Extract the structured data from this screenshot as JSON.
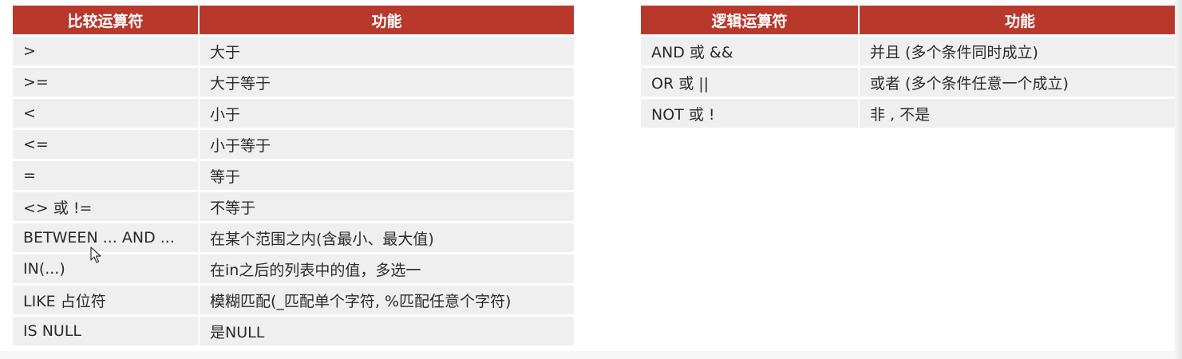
{
  "comparison_table": {
    "headers": [
      "比较运算符",
      "功能"
    ],
    "rows": [
      {
        "operator": ">",
        "function": "大于"
      },
      {
        "operator": ">=",
        "function": "大于等于"
      },
      {
        "operator": "<",
        "function": "小于"
      },
      {
        "operator": "<=",
        "function": "小于等于"
      },
      {
        "operator": "=",
        "function": "等于"
      },
      {
        "operator": "<> 或 !=",
        "function": "不等于"
      },
      {
        "operator": "BETWEEN ... AND ...",
        "function": "在某个范围之内(含最小、最大值)"
      },
      {
        "operator": "IN(...)",
        "function": "在in之后的列表中的值，多选一"
      },
      {
        "operator": "LIKE 占位符",
        "function": "模糊匹配(_匹配单个字符, %匹配任意个字符)"
      },
      {
        "operator": "IS NULL",
        "function": "是NULL"
      }
    ]
  },
  "logical_table": {
    "headers": [
      "逻辑运算符",
      "功能"
    ],
    "rows": [
      {
        "operator": "AND 或 &&",
        "function": "并且 (多个条件同时成立)"
      },
      {
        "operator": "OR 或 ||",
        "function": "或者 (多个条件任意一个成立)"
      },
      {
        "operator": "NOT 或 !",
        "function": "非 , 不是"
      }
    ]
  },
  "colors": {
    "header_bg": "#b8382b",
    "header_text": "#ffffff",
    "row_bg": "#efefef",
    "row_text": "#2b2b2b"
  },
  "cursor": {
    "icon": "mouse-pointer-icon"
  }
}
